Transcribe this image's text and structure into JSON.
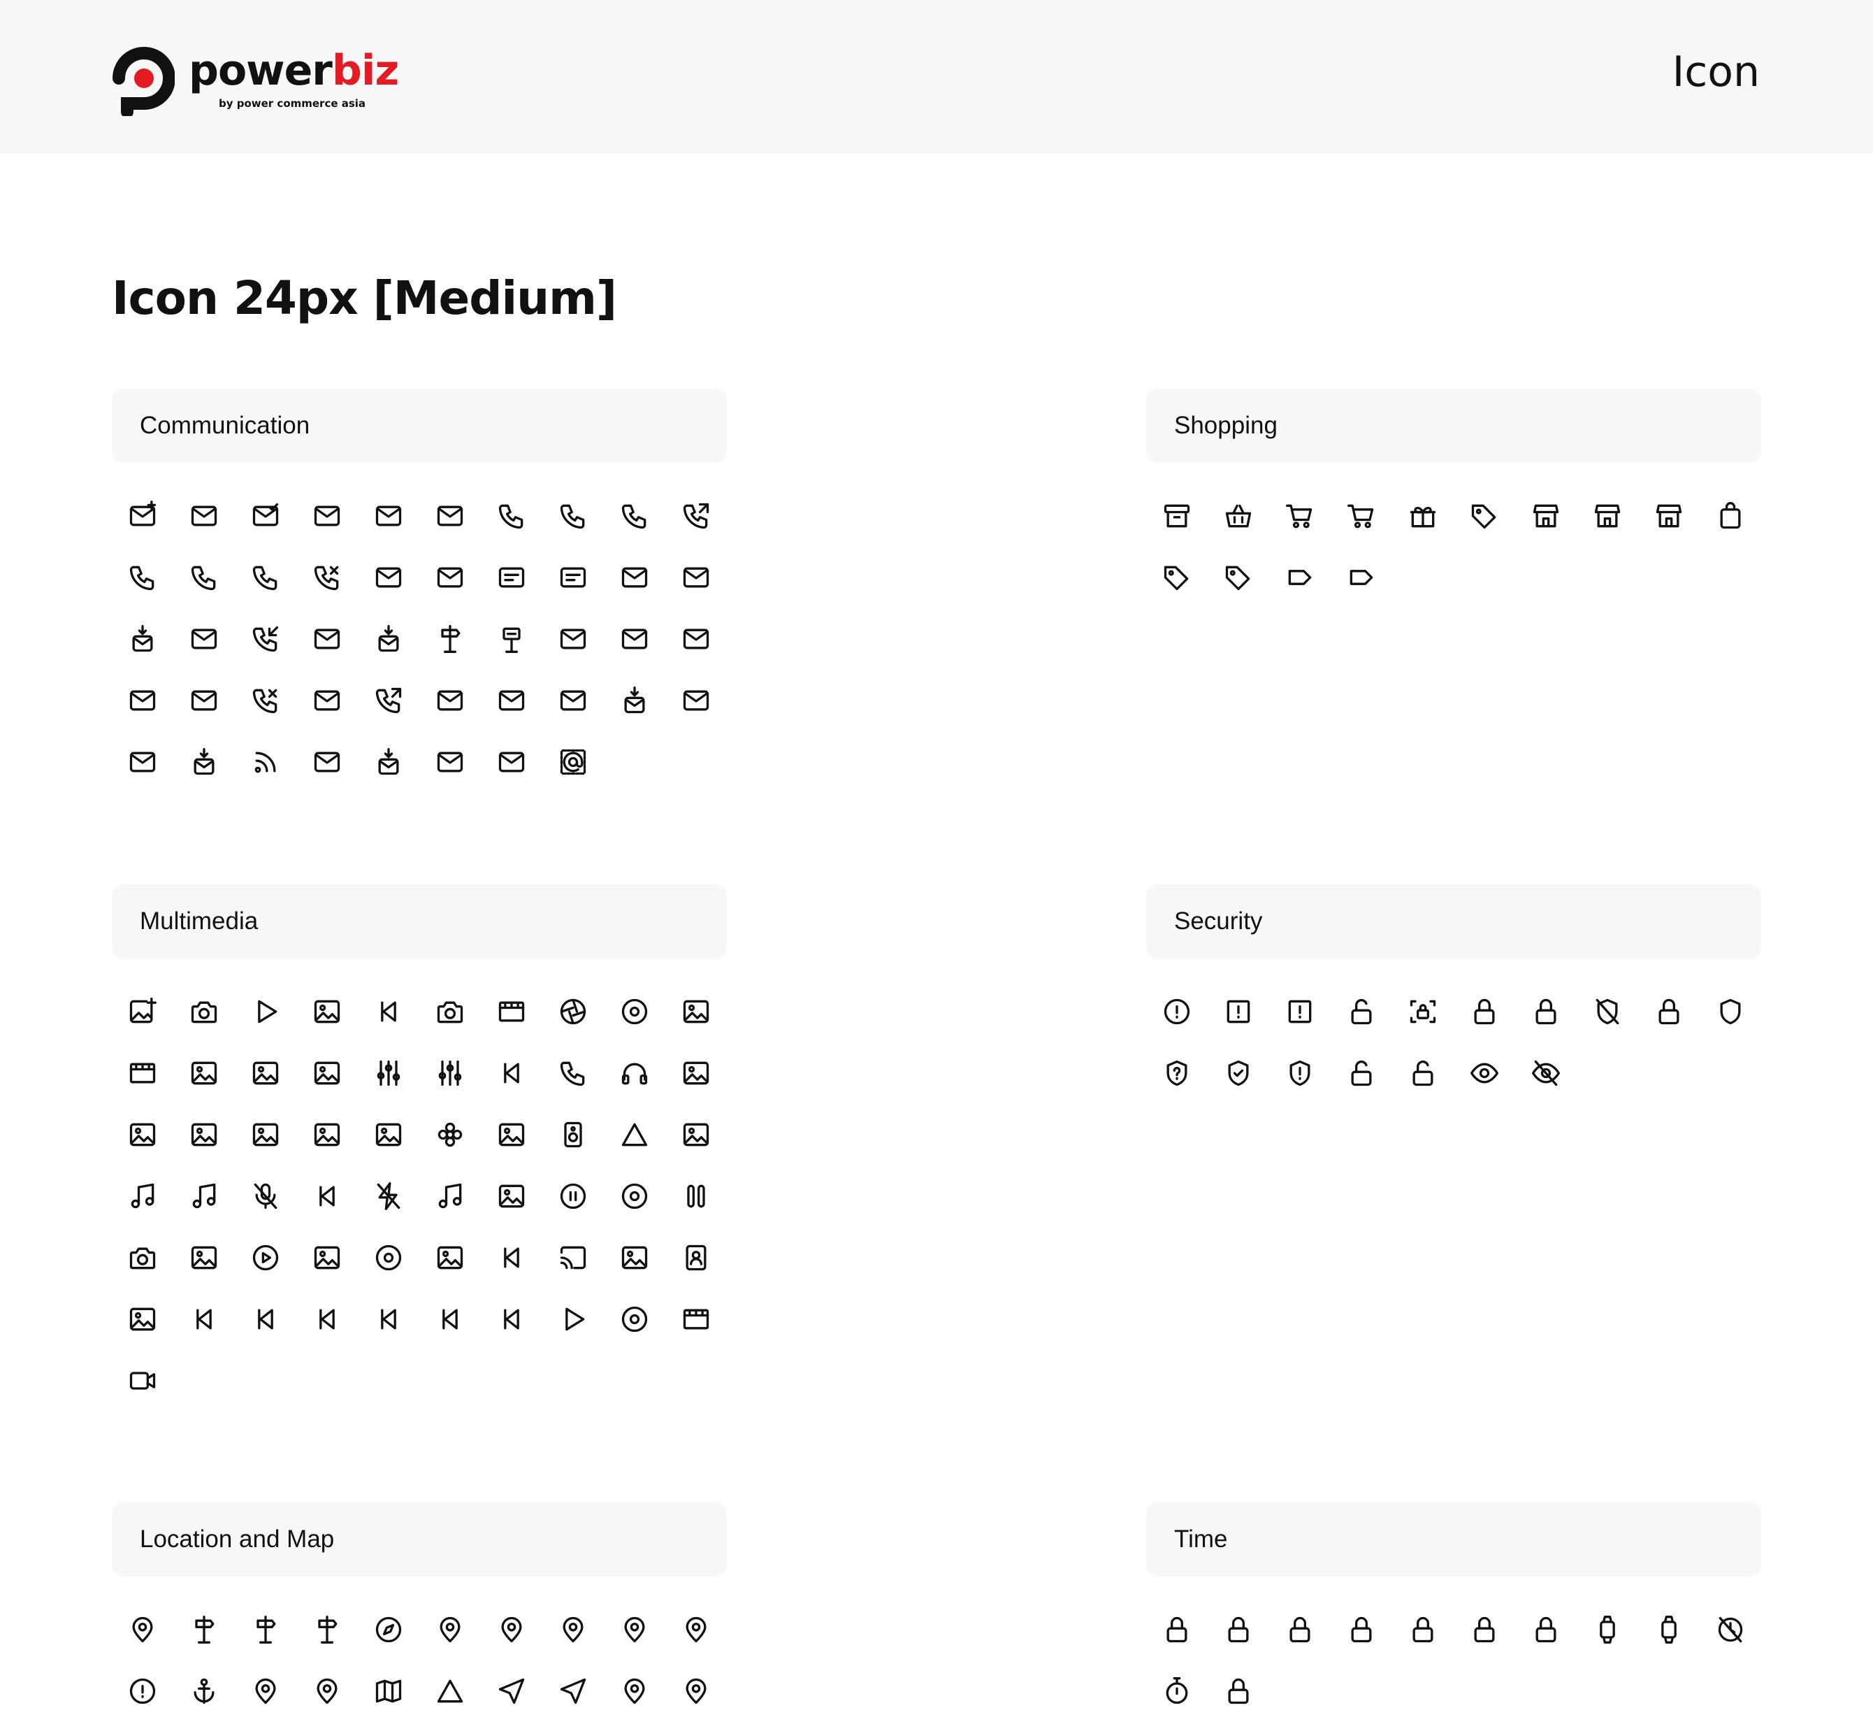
{
  "header": {
    "brand": {
      "prefix": "power",
      "accent": "biz",
      "tagline": "by power commerce asia"
    },
    "title": "Icon",
    "colors": {
      "brand_red": "#e31b23",
      "text": "#111111",
      "panel": "#f6f7f9"
    }
  },
  "page": {
    "title": "Icon 24px [Medium]"
  },
  "sections": [
    {
      "id": "communication",
      "label": "Communication",
      "icons": [
        "mail-add-icon",
        "mail-note-icon",
        "mail-check-icon",
        "mail-edit-icon",
        "mail-file-icon",
        "mail-star-icon",
        "phone-icon",
        "phone-outline-icon",
        "phone-dots-icon",
        "phone-forward-icon",
        "phone-call-icon",
        "phone-hangup-icon",
        "phone-pause-icon",
        "phone-missed-icon",
        "mail-close-icon",
        "desktop-mail-icon",
        "note-edit-icon",
        "id-card-icon",
        "mail-send-icon",
        "mail-out-icon",
        "mailbox-up-icon",
        "mail-question-icon",
        "phone-incoming-icon",
        "mail-info-icon",
        "mailbox-icon",
        "signpost-icon",
        "post-box-icon",
        "mail-heart-icon",
        "mail-lock-icon",
        "mail-icon",
        "mail-outline-icon",
        "mail-stack-icon",
        "phone-off-icon",
        "mail-open-icon",
        "phone-outgoing-icon",
        "mail-tower-icon",
        "mail-location-icon",
        "mail-download-icon",
        "mailbox-down-icon",
        "mail-refresh-icon",
        "mail-minus-icon",
        "mailbox-in-icon",
        "rss-icon",
        "mail-search-icon",
        "mailbox-out-icon",
        "mail-upload-icon",
        "mail-share-icon",
        "stamp-at-icon"
      ]
    },
    {
      "id": "shopping",
      "label": "Shopping",
      "icons": [
        "archive-icon",
        "basket-icon",
        "cart-icon",
        "cart-outline-icon",
        "gift-icon",
        "tag-icon",
        "shop-icon",
        "store-icon",
        "storefront-icon",
        "bag-icon",
        "tag-rotated-icon",
        "tag-outline-icon",
        "label-icon",
        "label-outline-icon"
      ]
    },
    {
      "id": "multimedia",
      "label": "Multimedia",
      "icons": [
        "image-add-icon",
        "camera-add-icon",
        "airplay-icon",
        "image-check-icon",
        "previous-icon",
        "camera-rotate-icon",
        "film-icon",
        "aperture-icon",
        "disc-icon",
        "image-upload-icon",
        "clapperboard-icon",
        "wave-image-icon",
        "image-close-icon",
        "image-download-icon",
        "equalizer-icon",
        "equalizer-alt-icon",
        "fast-forward-icon",
        "headphones-icon",
        "headset-icon",
        "image-question-icon",
        "image-frame-icon",
        "image-icon",
        "image-wide-icon",
        "image-info-icon",
        "image-refresh-icon",
        "flower-icon",
        "image-lock-icon",
        "speaker-icon",
        "mountain-icon",
        "gallery-icon",
        "music-icon",
        "music-note-icon",
        "mic-off-icon",
        "next-icon",
        "flash-off-icon",
        "music-off-icon",
        "image-edit-icon",
        "pause-circle-icon",
        "menu-circle-icon",
        "pause-icon",
        "camera-icon",
        "image-pen-icon",
        "play-circle-icon",
        "image-location-icon",
        "record-icon",
        "image-minus-icon",
        "rewind-icon",
        "cast-icon",
        "image-settings-icon",
        "contact-frame-icon",
        "image-share-icon",
        "skip-back-icon",
        "skip-back-circle-icon",
        "step-back-icon",
        "skip-forward-icon",
        "skip-forward-circle-icon",
        "step-forward-icon",
        "play-icon",
        "stop-circle-icon",
        "ticket-icon",
        "video-icon"
      ]
    },
    {
      "id": "security",
      "label": "Security",
      "icons": [
        "info-circle-icon",
        "alert-square-icon",
        "alert-box-icon",
        "unlock-icon",
        "scan-lock-icon",
        "lock-icon",
        "lock-outline-icon",
        "shield-off-icon",
        "lock-closed-icon",
        "shield-icon",
        "shield-question-icon",
        "shield-check-icon",
        "shield-alert-icon",
        "unlock-outline-icon",
        "unlock-alt-icon",
        "eye-icon",
        "eye-off-icon"
      ]
    },
    {
      "id": "location",
      "label": "Location and Map",
      "icons": [
        "pin-add-icon",
        "signpost-left-icon",
        "signpost-up-icon",
        "signpost-right-icon",
        "compass-icon",
        "pin-navigation-icon",
        "pin-question-icon",
        "pin-icon",
        "pin-outline-icon",
        "pin-ground-icon",
        "pin-info-icon",
        "anchor-icon",
        "person-pin-icon",
        "location-icon",
        "map-icon",
        "triangle-icon",
        "send-icon",
        "navigation-icon",
        "pin-minus-icon",
        "pin-target-icon"
      ]
    },
    {
      "id": "time",
      "label": "Time",
      "icons": [
        "clock-1-icon",
        "clock-2-icon",
        "clock-3-icon",
        "clock-4-icon",
        "clock-5-icon",
        "clock-6-icon",
        "clock-7-icon",
        "watch-icon",
        "smartwatch-icon",
        "alarm-off-icon",
        "stopwatch-icon",
        "clock-icon"
      ]
    }
  ]
}
